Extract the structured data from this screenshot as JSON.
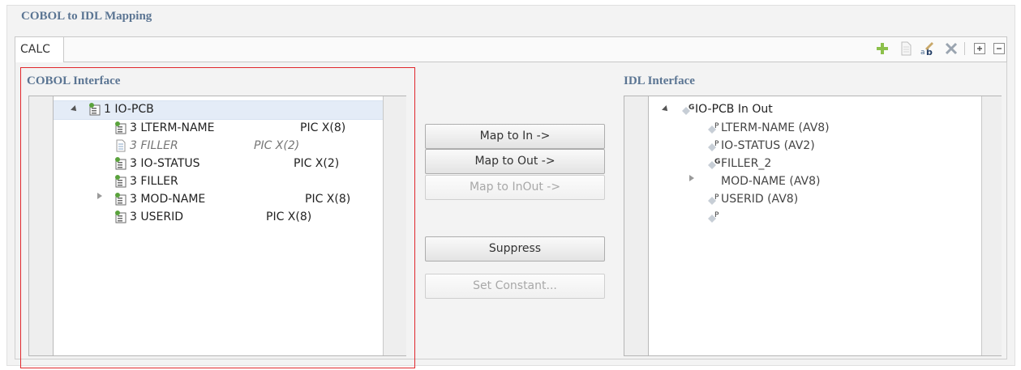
{
  "section_title": "COBOL to IDL Mapping",
  "tab": {
    "label": "CALC"
  },
  "toolbar": {
    "icons": [
      "add-icon",
      "document-icon",
      "rename-icon",
      "delete-icon",
      "expand-all-icon",
      "collapse-all-icon"
    ]
  },
  "cobol_panel": {
    "title": "COBOL Interface",
    "rows": [
      {
        "label": "1 IO-PCB",
        "pic": ""
      },
      {
        "label": "3 LTERM-NAME",
        "pic": "PIC X(8)"
      },
      {
        "label": "3 FILLER",
        "pic": "PIC X(2)"
      },
      {
        "label": "3 IO-STATUS",
        "pic": "PIC X(2)"
      },
      {
        "label": "3 FILLER",
        "pic": ""
      },
      {
        "label": "3 MOD-NAME",
        "pic": "PIC X(8)"
      },
      {
        "label": "3 USERID",
        "pic": "PIC X(8)"
      }
    ]
  },
  "buttons": {
    "map_in": "Map to In ->",
    "map_out": "Map to Out ->",
    "map_inout": "Map to InOut ->",
    "suppress": "Suppress",
    "set_constant": "Set Constant..."
  },
  "idl_panel": {
    "title": "IDL Interface",
    "rows": [
      {
        "badge": "G",
        "label": "IO-PCB  In Out"
      },
      {
        "badge": "P",
        "label": "LTERM-NAME  (AV8)"
      },
      {
        "badge": "P",
        "label": "IO-STATUS  (AV2)"
      },
      {
        "badge": "G",
        "label": "FILLER_2"
      },
      {
        "badge": "P",
        "label": "MOD-NAME  (AV8)"
      },
      {
        "badge": "P",
        "label": "USERID  (AV8)"
      }
    ]
  },
  "colors": {
    "title": "#5b7593",
    "highlight_border": "#e0272c",
    "selection": "#e4ecf7"
  }
}
